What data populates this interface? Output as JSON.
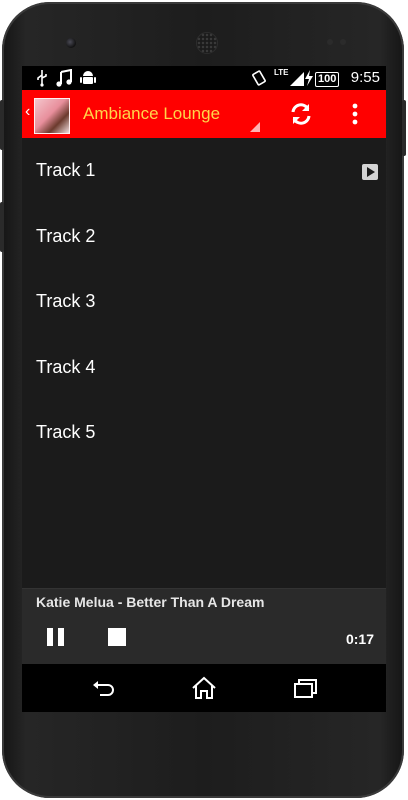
{
  "statusbar": {
    "time": "9:55",
    "network": "LTE",
    "battery": "100"
  },
  "actionbar": {
    "title": "Ambiance Lounge"
  },
  "tracks": [
    {
      "label": "Track 1",
      "playing": true
    },
    {
      "label": "Track 2",
      "playing": false
    },
    {
      "label": "Track 3",
      "playing": false
    },
    {
      "label": "Track 4",
      "playing": false
    },
    {
      "label": "Track 5",
      "playing": false
    }
  ],
  "player": {
    "now_playing": "Katie Melua - Better Than A Dream",
    "elapsed": "0:17"
  },
  "colors": {
    "actionbar_bg": "#ff0000",
    "title_color": "#ffd54a",
    "screen_bg": "#1b1b1b"
  }
}
